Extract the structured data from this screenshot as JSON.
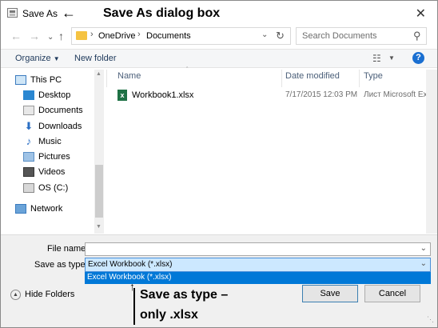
{
  "window": {
    "title": "Save As"
  },
  "annotations": {
    "title_callout": "Save As dialog box",
    "type_callout_line1": "Save as type –",
    "type_callout_line2": "only .xlsx"
  },
  "nav": {
    "breadcrumb": [
      "OneDrive",
      "Documents"
    ],
    "search_placeholder": "Search Documents"
  },
  "toolbar": {
    "organize": "Organize",
    "new_folder": "New folder"
  },
  "sidebar": {
    "items": [
      {
        "label": "This PC",
        "icon": "computer-icon"
      },
      {
        "label": "Desktop",
        "icon": "desktop-icon"
      },
      {
        "label": "Documents",
        "icon": "documents-icon"
      },
      {
        "label": "Downloads",
        "icon": "downloads-icon"
      },
      {
        "label": "Music",
        "icon": "music-icon"
      },
      {
        "label": "Pictures",
        "icon": "pictures-icon"
      },
      {
        "label": "Videos",
        "icon": "videos-icon"
      },
      {
        "label": "OS (C:)",
        "icon": "drive-icon"
      },
      {
        "label": "Network",
        "icon": "network-icon"
      }
    ]
  },
  "columns": {
    "name": "Name",
    "date": "Date modified",
    "type": "Type"
  },
  "files": [
    {
      "name": "Workbook1.xlsx",
      "date": "7/17/2015 12:03 PM",
      "type": "Лист Microsoft Ex..."
    }
  ],
  "form": {
    "file_name_label": "File name:",
    "file_name_value": "",
    "save_type_label": "Save as type:",
    "save_type_value": "Excel Workbook (*.xlsx)",
    "dropdown_options": [
      "Excel Workbook (*.xlsx)"
    ]
  },
  "footer": {
    "hide_folders": "Hide Folders",
    "save": "Save",
    "cancel": "Cancel"
  },
  "colors": {
    "accent": "#cce8ff",
    "selection": "#0078d7",
    "excel_green": "#1e7145",
    "folder_yellow": "#f5c342",
    "help_blue": "#1a6fd1"
  }
}
